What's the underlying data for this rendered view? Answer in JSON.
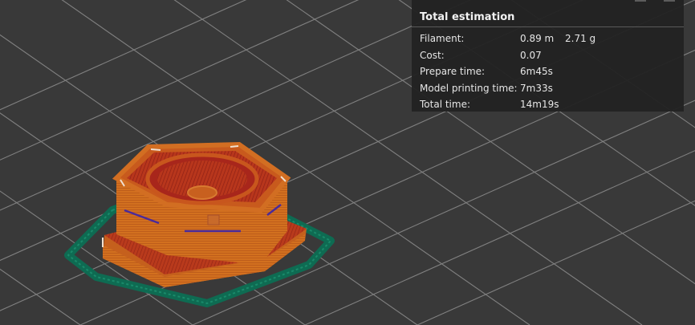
{
  "estimation": {
    "title": "Total estimation",
    "rows": [
      {
        "label": "Filament:",
        "value": "0.89 m",
        "extra": "2.71 g"
      },
      {
        "label": "Cost:",
        "value": "0.07",
        "extra": ""
      },
      {
        "label": "Prepare time:",
        "value": "6m45s",
        "extra": ""
      },
      {
        "label": "Model printing time:",
        "value": "7m33s",
        "extra": ""
      },
      {
        "label": "Total time:",
        "value": "14m19s",
        "extra": ""
      }
    ]
  },
  "colors": {
    "plate": "#393939",
    "grid_line": "#8a8a8a",
    "model_wall": "#d06a1f",
    "model_top": "#b33a1e",
    "infill": "#a8261b",
    "support_purple": "#4a2a9a",
    "skirt": "#0f6e55",
    "panel_bg": "#222222"
  }
}
